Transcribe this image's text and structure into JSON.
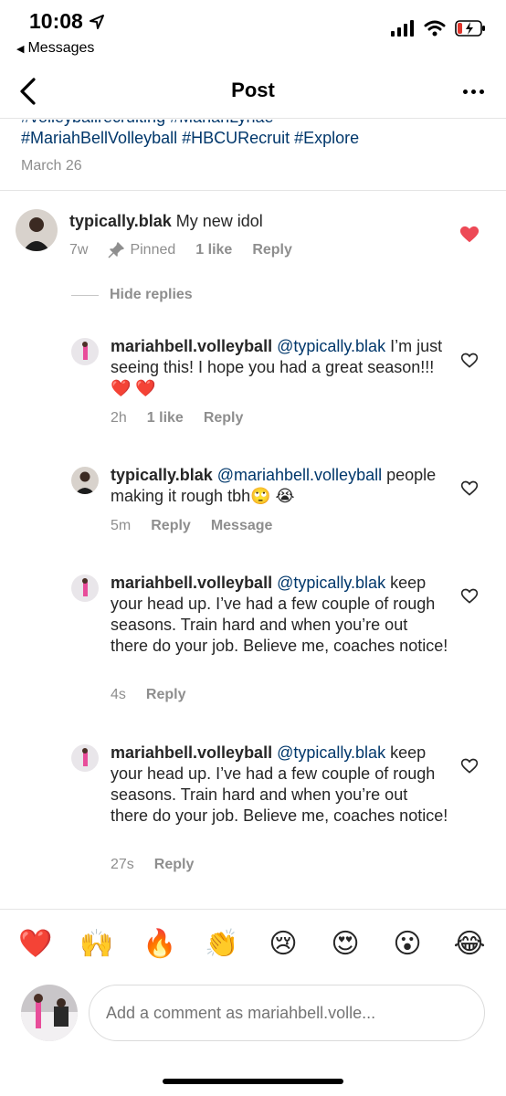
{
  "status_bar": {
    "time": "10:08",
    "back_app": "Messages"
  },
  "nav": {
    "title": "Post"
  },
  "caption": {
    "cut_line": "#volleyballrecruiting #MariahLynae",
    "tags_line": "#MariahBellVolleyball #HBCURecruit #Explore",
    "date": "March 26"
  },
  "top_comment": {
    "username": "typically.blak",
    "text": "My new idol",
    "time": "7w",
    "pinned": "Pinned",
    "likes": "1 like",
    "reply": "Reply",
    "liked": true
  },
  "hide_replies": "Hide replies",
  "replies": [
    {
      "username": "mariahbell.volleyball",
      "mention": "@typically.blak",
      "text": "I’m just seeing this! I hope you had a great season!!! ❤️ ❤️",
      "time": "2h",
      "likes": "1 like",
      "action1": "Reply",
      "action2": ""
    },
    {
      "username": "typically.blak",
      "mention": "@mariahbell.volleyball",
      "text": "people making it rough tbh🙄 😭",
      "time": "5m",
      "likes": "",
      "action1": "Reply",
      "action2": "Message"
    },
    {
      "username": "mariahbell.volleyball",
      "mention": "@typically.blak",
      "text": "keep your head up. I’ve had a few couple of rough seasons. Train hard and when you’re out there do your job. Believe me, coaches notice!",
      "time": "4s",
      "likes": "",
      "action1": "Reply",
      "action2": ""
    },
    {
      "username": "mariahbell.volleyball",
      "mention": "@typically.blak",
      "text": "keep your head up. I’ve had a few couple of rough seasons. Train hard and when you’re out there do your job. Believe me, coaches notice!",
      "time": "27s",
      "likes": "",
      "action1": "Reply",
      "action2": ""
    }
  ],
  "emoji_bar": [
    "❤️",
    "🙌",
    "🔥",
    "👏",
    "😢",
    "😍",
    "😮",
    "😂"
  ],
  "input": {
    "placeholder": "Add a comment as mariahbell.volle..."
  },
  "colors": {
    "link": "#00376b",
    "muted": "#8e8e8e",
    "like_red": "#ed4956"
  }
}
